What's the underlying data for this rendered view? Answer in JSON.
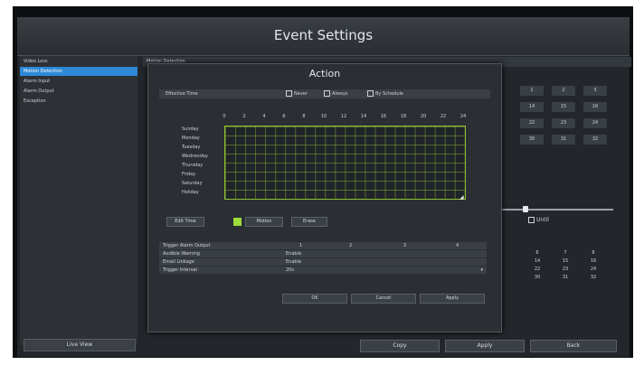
{
  "window": {
    "title": "Event Settings"
  },
  "sidebar": {
    "items": [
      {
        "label": "Video Loss",
        "active": false
      },
      {
        "label": "Motion Detection",
        "active": true
      },
      {
        "label": "Alarm Input",
        "active": false
      },
      {
        "label": "Alarm Output",
        "active": false
      },
      {
        "label": "Exception",
        "active": false
      }
    ],
    "live_view": "Live View"
  },
  "main": {
    "section_label": "Motion Detection",
    "until_label": "Until",
    "background_days_top": [
      [
        "1",
        "2",
        "3"
      ],
      [
        "14",
        "15",
        "16"
      ],
      [
        "22",
        "23",
        "24"
      ],
      [
        "30",
        "31",
        "32"
      ]
    ],
    "background_days_bottom": [
      [
        "6",
        "7",
        "8"
      ],
      [
        "14",
        "15",
        "16"
      ],
      [
        "22",
        "23",
        "24"
      ],
      [
        "30",
        "31",
        "32"
      ]
    ]
  },
  "footer": {
    "copy": "Copy",
    "apply": "Apply",
    "back": "Back"
  },
  "dialog": {
    "title": "Action",
    "effective_time_label": "Effective Time",
    "options": [
      "Never",
      "Always",
      "By Schedule"
    ],
    "hours": [
      "0",
      "2",
      "4",
      "6",
      "8",
      "10",
      "12",
      "14",
      "16",
      "18",
      "20",
      "22",
      "24"
    ],
    "days": [
      "Sunday",
      "Monday",
      "Tuesday",
      "Wednesday",
      "Thursday",
      "Friday",
      "Saturday",
      "Holiday"
    ],
    "edit_time": "Edit Time",
    "motion": "Motion",
    "erase": "Erase",
    "rows": [
      {
        "label": "Trigger Alarm Output",
        "values": [
          "1",
          "2",
          "3",
          "4"
        ]
      },
      {
        "label": "Audible Warning",
        "values": [
          "Enable"
        ]
      },
      {
        "label": "Email Linkage",
        "values": [
          "Enable"
        ]
      },
      {
        "label": "Trigger Interval",
        "values": [
          "20s"
        ]
      }
    ],
    "ok": "OK",
    "cancel": "Cancel",
    "apply": "Apply",
    "motion_color": "#9dde3c"
  }
}
